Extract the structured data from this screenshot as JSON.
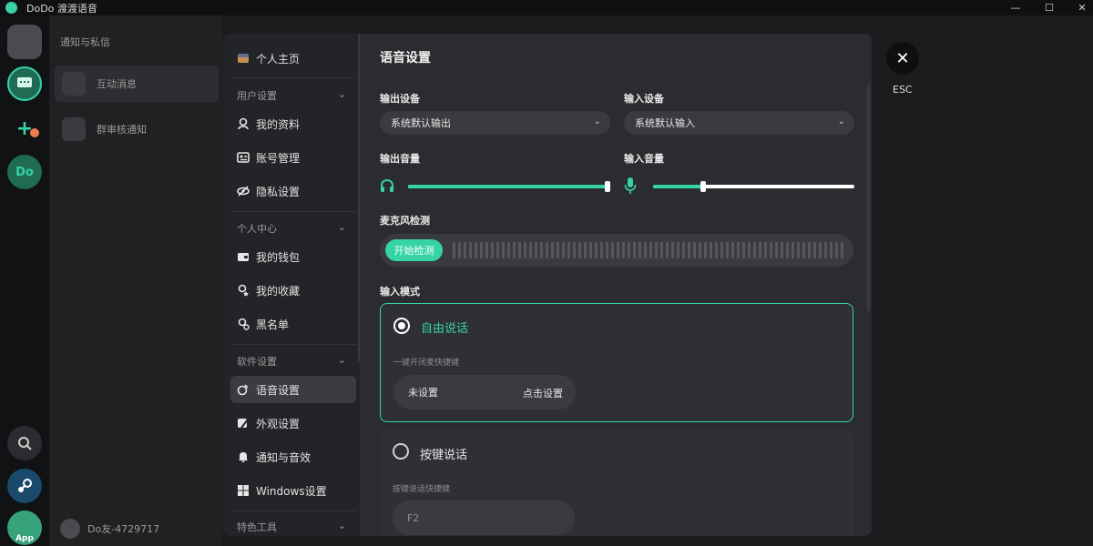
{
  "window": {
    "title": "DoDo 渡渡语音",
    "min": "—",
    "max": "☐",
    "close": "✕"
  },
  "rail": {
    "app_label": "App",
    "dodo_label": "Do"
  },
  "background": {
    "header_left": "通知与私信",
    "header_right": "互动消息",
    "items": [
      {
        "label": "互动消息"
      },
      {
        "label": "群审核通知"
      }
    ],
    "user": "Do友-4729717"
  },
  "nav": {
    "items": [
      {
        "label": "个人主页",
        "icon": "profile-icon"
      },
      {
        "section": "用户设置"
      },
      {
        "label": "我的资料",
        "icon": "user-icon"
      },
      {
        "label": "账号管理",
        "icon": "id-card-icon"
      },
      {
        "label": "隐私设置",
        "icon": "eye-off-icon"
      },
      {
        "section": "个人中心"
      },
      {
        "label": "我的钱包",
        "icon": "wallet-icon"
      },
      {
        "label": "我的收藏",
        "icon": "star-icon"
      },
      {
        "label": "黑名单",
        "icon": "block-user-icon"
      },
      {
        "section": "软件设置"
      },
      {
        "label": "语音设置",
        "icon": "voice-icon"
      },
      {
        "label": "外观设置",
        "icon": "palette-icon"
      },
      {
        "label": "通知与音效",
        "icon": "bell-icon"
      },
      {
        "label": "Windows设置",
        "icon": "windows-icon"
      },
      {
        "section": "特色工具"
      }
    ]
  },
  "voice": {
    "title": "语音设置",
    "output_label": "输出设备",
    "output_value": "系统默认输出",
    "input_label": "输入设备",
    "input_value": "系统默认输入",
    "output_volume_label": "输出音量",
    "input_volume_label": "输入音量",
    "output_volume": 1.0,
    "input_volume": 0.25,
    "mic_test_label": "麦克风检测",
    "mic_test_button": "开始检测",
    "input_mode_label": "输入模式",
    "mode_free": {
      "label": "自由说话",
      "sub": "一键开闭麦快捷键",
      "hotkey": "未设置",
      "action": "点击设置"
    },
    "mode_ptt": {
      "label": "按键说话",
      "sub": "按键说话快捷键",
      "hotkey": "F2"
    }
  },
  "esc": {
    "label": "ESC"
  },
  "colors": {
    "accent": "#36d3a6"
  }
}
